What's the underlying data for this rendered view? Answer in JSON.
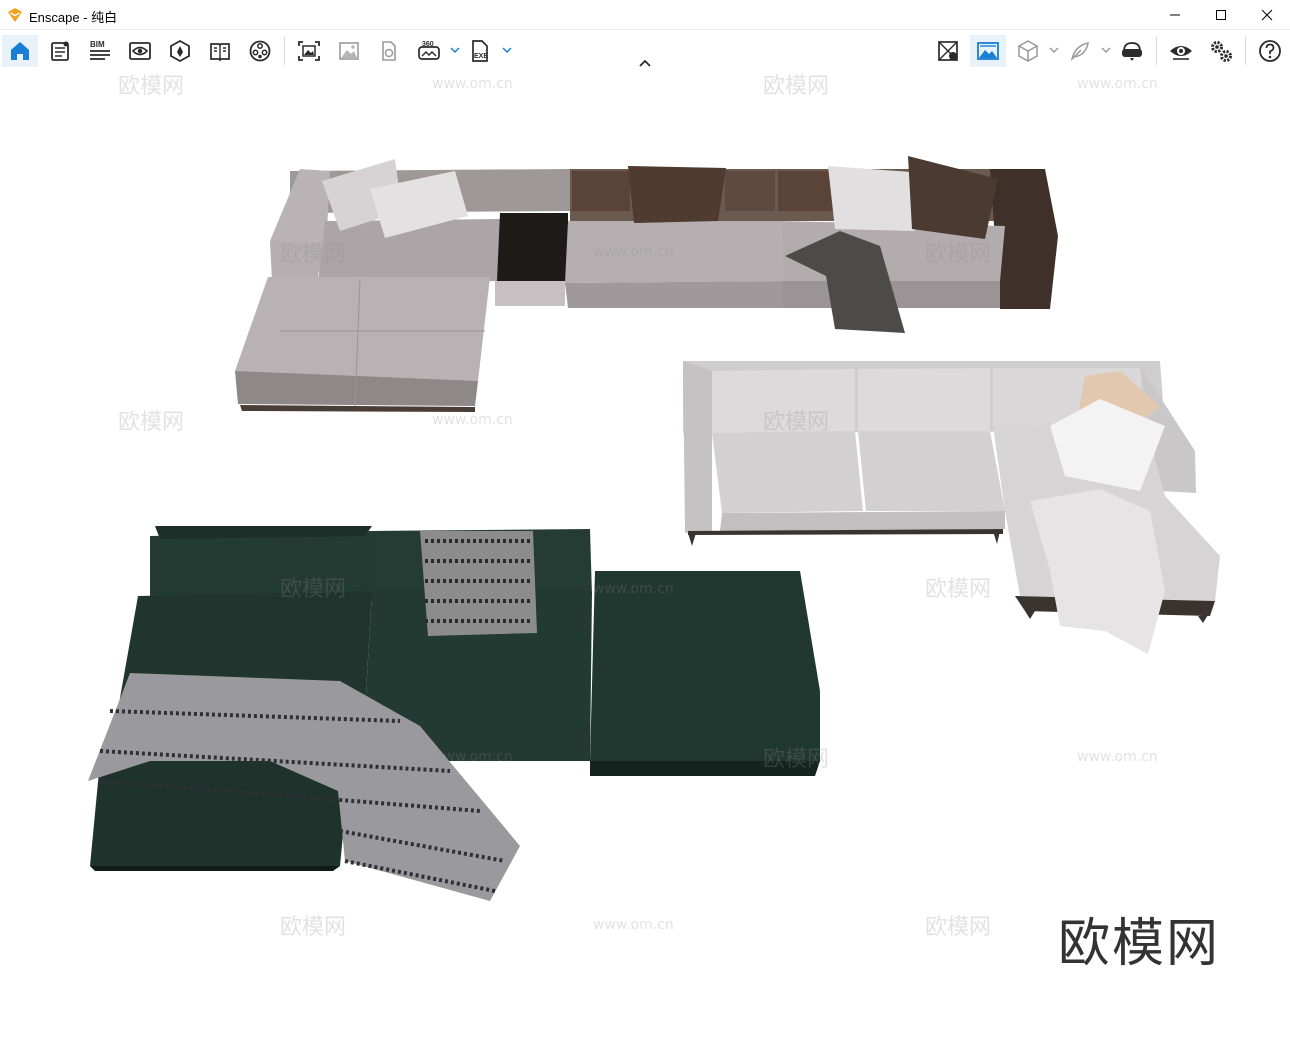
{
  "window": {
    "title": "Enscape - 纯白",
    "controls": [
      "minimize",
      "maximize",
      "close"
    ]
  },
  "toolbar": {
    "left_tools": [
      {
        "name": "home",
        "icon": "home-icon",
        "active": true
      },
      {
        "name": "notes",
        "icon": "notes-icon"
      },
      {
        "name": "bim",
        "icon": "bim-icon",
        "label": "BIM"
      },
      {
        "name": "views",
        "icon": "view-eye-icon"
      },
      {
        "name": "site-context",
        "icon": "site-context-icon"
      },
      {
        "name": "material-book",
        "icon": "material-book-icon"
      },
      {
        "name": "asset-library",
        "icon": "asset-library-icon"
      },
      {
        "name": "screenshot",
        "icon": "screenshot-icon"
      },
      {
        "name": "batch-render",
        "icon": "batch-render-icon"
      },
      {
        "name": "panorama",
        "icon": "panorama-icon"
      },
      {
        "name": "render-360",
        "icon": "render-360-icon",
        "label": "360"
      },
      {
        "name": "export-exe",
        "icon": "export-exe-icon",
        "label": "EXE"
      }
    ],
    "right_tools": [
      {
        "name": "material-editor",
        "icon": "material-editor-icon"
      },
      {
        "name": "sync-updates",
        "icon": "sync-image-icon",
        "active": true
      },
      {
        "name": "orthographic",
        "icon": "cube-icon"
      },
      {
        "name": "capture-feather",
        "icon": "feather-icon"
      },
      {
        "name": "vr-headset",
        "icon": "vr-headset-icon"
      },
      {
        "name": "visual-settings",
        "icon": "eye-icon"
      },
      {
        "name": "general-settings",
        "icon": "gears-icon"
      },
      {
        "name": "help",
        "icon": "help-icon"
      }
    ]
  },
  "viewport": {
    "watermark_text": "欧模网",
    "watermark_url": "www.om.cn",
    "brand_logo": "欧模网"
  },
  "colors": {
    "accent": "#1a7fd4",
    "icon": "#2b2b2b",
    "active_bg": "#e8f2fb"
  }
}
